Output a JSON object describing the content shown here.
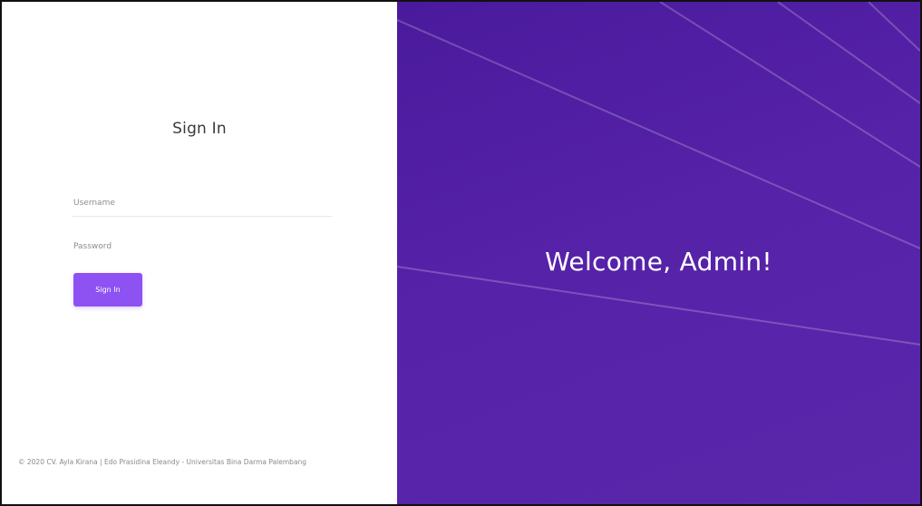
{
  "login": {
    "title": "Sign In",
    "username_placeholder": "Username",
    "password_placeholder": "Password",
    "signin_label": "Sign In"
  },
  "footer": {
    "text": "© 2020 CV. Ayla Kirana | Edo Prasidina Eleandy - Universitas Bina Darma Palembang"
  },
  "hero": {
    "welcome_text": "Welcome, Admin!"
  },
  "colors": {
    "accent": "#8e52f2",
    "hero_background": "#5622a8",
    "text": "#3a3a3a"
  }
}
